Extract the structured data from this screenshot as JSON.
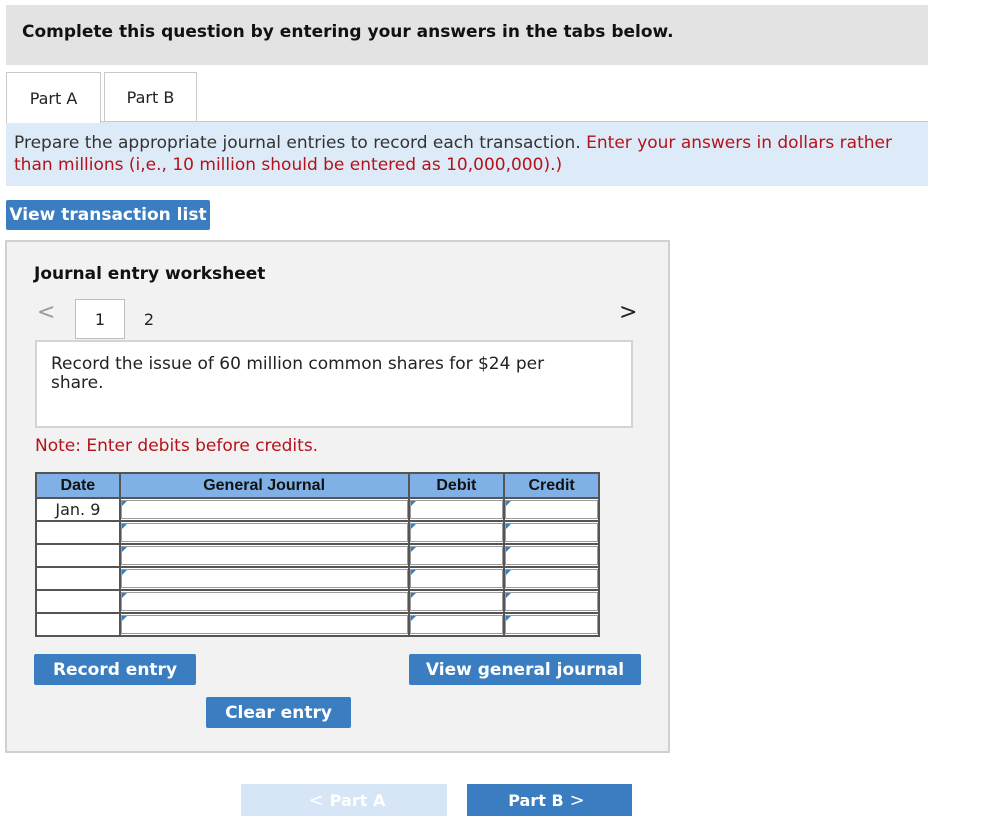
{
  "banner": {
    "text": "Complete this question by entering your answers in the tabs below."
  },
  "tabs": [
    {
      "label": "Part A",
      "active": true
    },
    {
      "label": "Part B",
      "active": false
    }
  ],
  "instructions": {
    "text": "Prepare the appropriate journal entries to record each transaction.",
    "highlight": "Enter your answers in dollars rather than millions (i,e., 10 million should be entered as 10,000,000).)"
  },
  "buttons": {
    "view_transaction_list": "View transaction list",
    "record_entry": "Record entry",
    "clear_entry": "Clear entry",
    "view_general_journal": "View general journal"
  },
  "worksheet": {
    "title": "Journal entry worksheet",
    "pages": [
      "1",
      "2"
    ],
    "current_page": "1",
    "prev_icon": "<",
    "next_icon": ">",
    "description": "Record the issue of 60 million common shares for $24 per share.",
    "note": "Note: Enter debits before credits."
  },
  "journal": {
    "headers": {
      "date": "Date",
      "general_journal": "General Journal",
      "debit": "Debit",
      "credit": "Credit"
    },
    "rows": [
      {
        "date": "Jan. 9",
        "account": "",
        "debit": "",
        "credit": ""
      },
      {
        "date": "",
        "account": "",
        "debit": "",
        "credit": ""
      },
      {
        "date": "",
        "account": "",
        "debit": "",
        "credit": ""
      },
      {
        "date": "",
        "account": "",
        "debit": "",
        "credit": ""
      },
      {
        "date": "",
        "account": "",
        "debit": "",
        "credit": ""
      },
      {
        "date": "",
        "account": "",
        "debit": "",
        "credit": ""
      }
    ]
  },
  "footer_nav": {
    "prev_label": "Part A",
    "prev_icon": "<",
    "next_label": "Part B",
    "next_icon": ">"
  },
  "colors": {
    "accent": "#3a7ec1",
    "instruction_bg": "#dcebf7",
    "highlight_text": "#b5121b",
    "table_header": "#7fb1e6"
  }
}
